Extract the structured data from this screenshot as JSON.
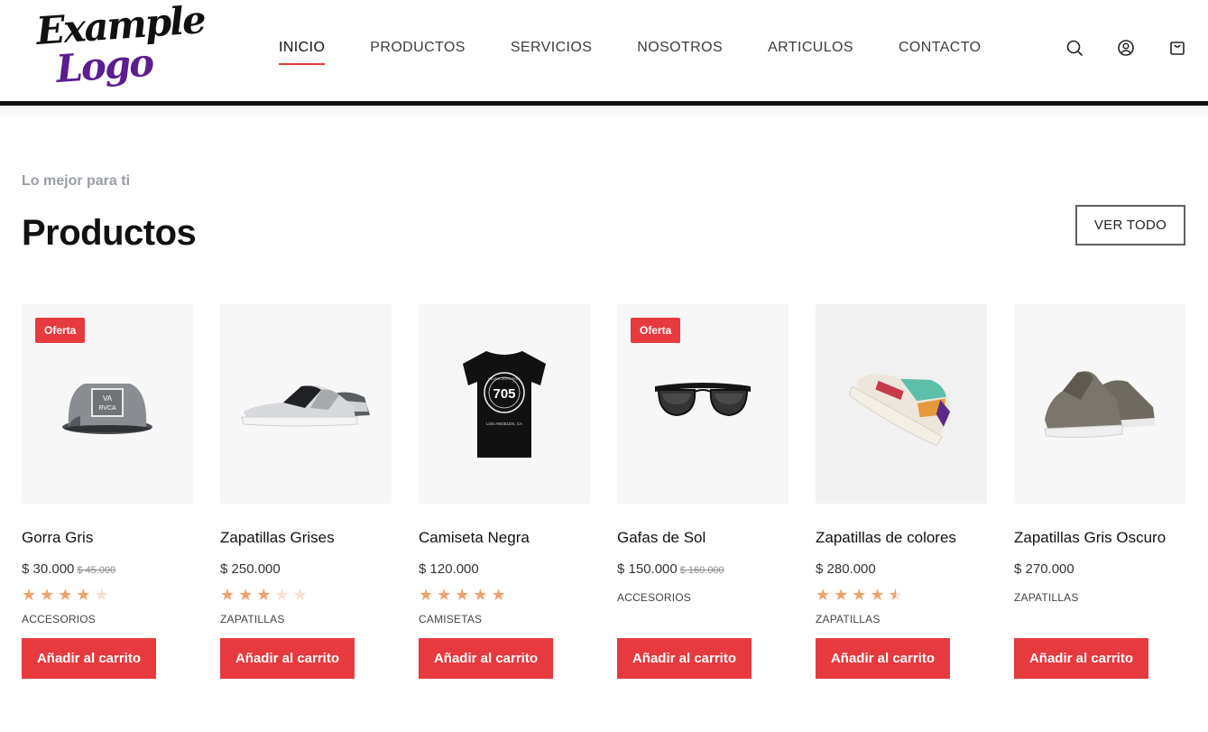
{
  "logo": {
    "line1": "Example",
    "line2": "Logo"
  },
  "nav": {
    "items": [
      {
        "label": "INICIO",
        "active": true
      },
      {
        "label": "PRODUCTOS",
        "active": false
      },
      {
        "label": "SERVICIOS",
        "active": false
      },
      {
        "label": "NOSOTROS",
        "active": false
      },
      {
        "label": "ARTICULOS",
        "active": false
      },
      {
        "label": "CONTACTO",
        "active": false
      }
    ]
  },
  "header_icons": [
    "search-icon",
    "user-icon",
    "cart-icon"
  ],
  "section": {
    "eyebrow": "Lo mejor para ti",
    "title": "Productos",
    "view_all_label": "VER TODO"
  },
  "products": [
    {
      "name": "Gorra Gris",
      "price": "$ 30.000",
      "old_price": "$ 45.000",
      "badge": "Oferta",
      "rating": 4,
      "category": "ACCESORIOS",
      "button": "Añadir al carrito",
      "image": "cap"
    },
    {
      "name": "Zapatillas Grises",
      "price": "$ 250.000",
      "old_price": "",
      "badge": "",
      "rating": 3,
      "category": "ZAPATILLAS",
      "button": "Añadir al carrito",
      "image": "sneaker-low"
    },
    {
      "name": "Camiseta Negra",
      "price": "$ 120.000",
      "old_price": "",
      "badge": "",
      "rating": 5,
      "category": "CAMISETAS",
      "button": "Añadir al carrito",
      "image": "tshirt",
      "tshirt_text": "705",
      "tshirt_ring": "SEVEN ZERO FIVE",
      "tshirt_caption": "LOS ANGELES, CA"
    },
    {
      "name": "Gafas de Sol",
      "price": "$ 150.000",
      "old_price": "$ 160.000",
      "badge": "Oferta",
      "rating": 0,
      "category": "ACCESORIOS",
      "button": "Añadir al carrito",
      "image": "sunglasses"
    },
    {
      "name": "Zapatillas de colores",
      "price": "$ 280.000",
      "old_price": "",
      "badge": "",
      "rating": 4.5,
      "category": "ZAPATILLAS",
      "button": "Añadir al carrito",
      "image": "sneaker-color"
    },
    {
      "name": "Zapatillas Gris Oscuro",
      "price": "$ 270.000",
      "old_price": "",
      "badge": "",
      "rating": 0,
      "category": "ZAPATILLAS",
      "button": "Añadir al carrito",
      "image": "sneaker-dark"
    }
  ],
  "colors": {
    "accent": "#e63a3f",
    "star": "#f2a06a",
    "logo_purple": "#5b1d8f"
  }
}
